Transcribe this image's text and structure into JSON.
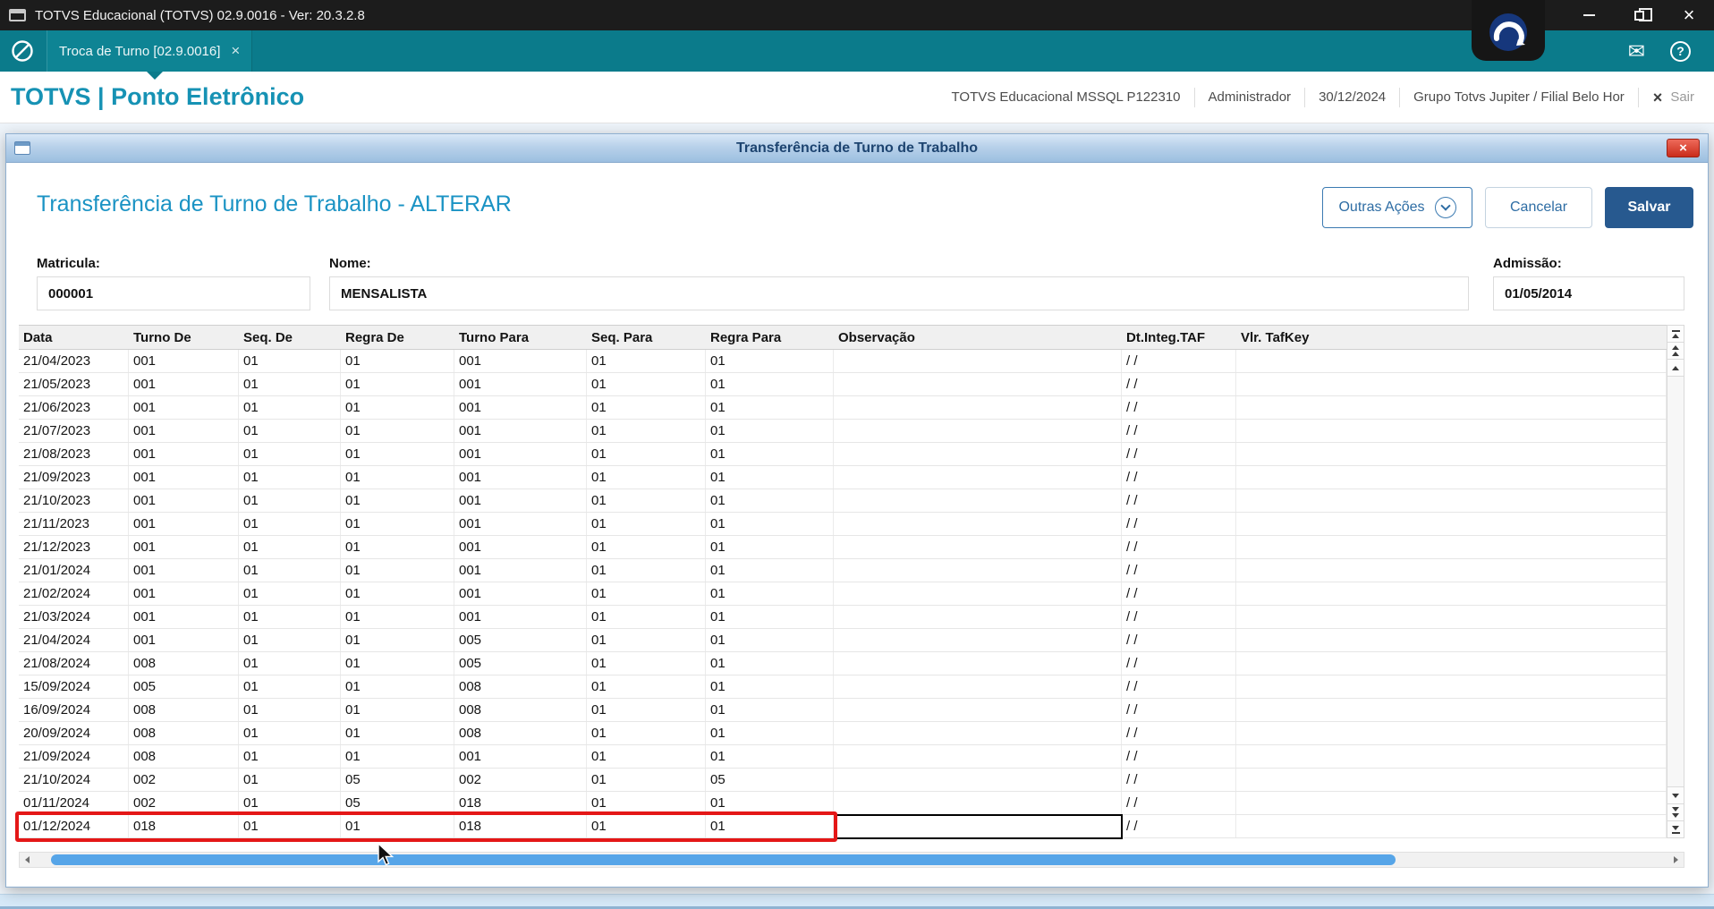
{
  "titlebar": {
    "title": "TOTVS Educacional (TOTVS) 02.9.0016 - Ver: 20.3.2.8"
  },
  "tabbar": {
    "active_tab": "Troca de Turno [02.9.0016]"
  },
  "header": {
    "app_title": "TOTVS | Ponto Eletrônico",
    "environment": "TOTVS Educacional MSSQL P122310",
    "user": "Administrador",
    "date": "30/12/2024",
    "company": "Grupo Totvs Jupiter / Filial Belo Hor",
    "exit_label": "Sair"
  },
  "icons": {
    "mail": "✉",
    "help": "?",
    "window_close": "×",
    "tab_close": "×",
    "modal_close": "×",
    "sair_x": "×"
  },
  "dialog": {
    "title": "Transferência de Turno de Trabalho",
    "heading": "Transferência de Turno de Trabalho - ALTERAR",
    "actions": {
      "other_actions": "Outras Ações",
      "cancel": "Cancelar",
      "save": "Salvar"
    },
    "fields": {
      "matricula": {
        "label": "Matricula:",
        "value": "000001"
      },
      "nome": {
        "label": "Nome:",
        "value": "MENSALISTA"
      },
      "admissao": {
        "label": "Admissão:",
        "value": "01/05/2014"
      }
    }
  },
  "grid": {
    "columns": [
      "Data",
      "Turno De",
      "Seq. De",
      "Regra De",
      "Turno Para",
      "Seq. Para",
      "Regra Para",
      "Observação",
      "Dt.Integ.TAF",
      "Vlr. TafKey"
    ],
    "rows": [
      [
        "21/04/2023",
        "001",
        "01",
        "01",
        "001",
        "01",
        "01",
        "",
        "/ /",
        ""
      ],
      [
        "21/05/2023",
        "001",
        "01",
        "01",
        "001",
        "01",
        "01",
        "",
        "/ /",
        ""
      ],
      [
        "21/06/2023",
        "001",
        "01",
        "01",
        "001",
        "01",
        "01",
        "",
        "/ /",
        ""
      ],
      [
        "21/07/2023",
        "001",
        "01",
        "01",
        "001",
        "01",
        "01",
        "",
        "/ /",
        ""
      ],
      [
        "21/08/2023",
        "001",
        "01",
        "01",
        "001",
        "01",
        "01",
        "",
        "/ /",
        ""
      ],
      [
        "21/09/2023",
        "001",
        "01",
        "01",
        "001",
        "01",
        "01",
        "",
        "/ /",
        ""
      ],
      [
        "21/10/2023",
        "001",
        "01",
        "01",
        "001",
        "01",
        "01",
        "",
        "/ /",
        ""
      ],
      [
        "21/11/2023",
        "001",
        "01",
        "01",
        "001",
        "01",
        "01",
        "",
        "/ /",
        ""
      ],
      [
        "21/12/2023",
        "001",
        "01",
        "01",
        "001",
        "01",
        "01",
        "",
        "/ /",
        ""
      ],
      [
        "21/01/2024",
        "001",
        "01",
        "01",
        "001",
        "01",
        "01",
        "",
        "/ /",
        ""
      ],
      [
        "21/02/2024",
        "001",
        "01",
        "01",
        "001",
        "01",
        "01",
        "",
        "/ /",
        ""
      ],
      [
        "21/03/2024",
        "001",
        "01",
        "01",
        "001",
        "01",
        "01",
        "",
        "/ /",
        ""
      ],
      [
        "21/04/2024",
        "001",
        "01",
        "01",
        "005",
        "01",
        "01",
        "",
        "/ /",
        ""
      ],
      [
        "21/08/2024",
        "008",
        "01",
        "01",
        "005",
        "01",
        "01",
        "",
        "/ /",
        ""
      ],
      [
        "15/09/2024",
        "005",
        "01",
        "01",
        "008",
        "01",
        "01",
        "",
        "/ /",
        ""
      ],
      [
        "16/09/2024",
        "008",
        "01",
        "01",
        "008",
        "01",
        "01",
        "",
        "/ /",
        ""
      ],
      [
        "20/09/2024",
        "008",
        "01",
        "01",
        "008",
        "01",
        "01",
        "",
        "/ /",
        ""
      ],
      [
        "21/09/2024",
        "008",
        "01",
        "01",
        "001",
        "01",
        "01",
        "",
        "/ /",
        ""
      ],
      [
        "21/10/2024",
        "002",
        "01",
        "05",
        "002",
        "01",
        "05",
        "",
        "/ /",
        ""
      ],
      [
        "01/11/2024",
        "002",
        "01",
        "05",
        "018",
        "01",
        "01",
        "",
        "/ /",
        ""
      ],
      [
        "01/12/2024",
        "018",
        "01",
        "01",
        "018",
        "01",
        "01",
        "",
        "/ /",
        ""
      ]
    ],
    "highlight": {
      "row_index": 20,
      "red_border_column_count": 7,
      "focused_column": "Observação"
    }
  },
  "colors": {
    "accent_teal": "#0b7b8b",
    "heading_blue": "#1b93c4",
    "save_button_blue": "#27598f",
    "highlight_red": "#e41717",
    "scrollbar_thumb_blue": "#56a5e8",
    "modal_titlebar_blue": "#9cbfe0"
  }
}
